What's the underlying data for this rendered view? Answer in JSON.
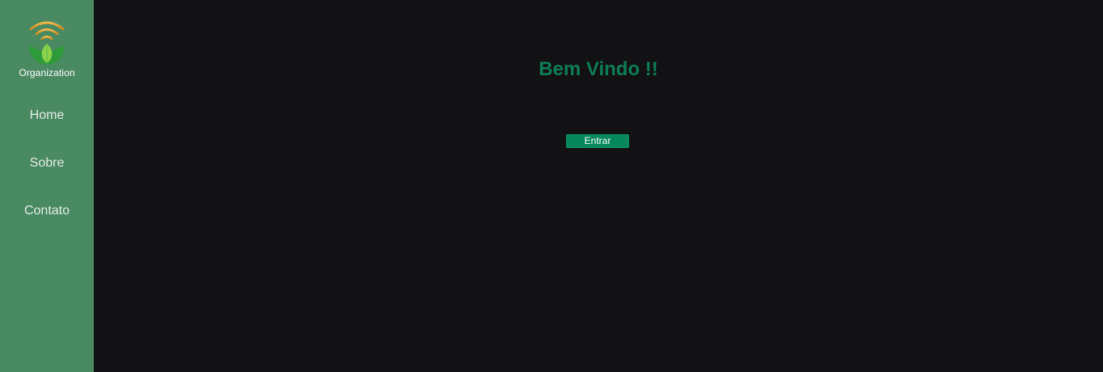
{
  "brand": {
    "name": "Organization",
    "icon": "sprout-signal-logo-icon",
    "colors": {
      "signal": "#e0a63a",
      "leaf_light": "#8bd34a",
      "leaf_dark": "#2e9b3a"
    }
  },
  "sidebar": {
    "background": "#4a8a62",
    "items": [
      {
        "label": "Home"
      },
      {
        "label": "Sobre"
      },
      {
        "label": "Contato"
      }
    ]
  },
  "main": {
    "background": "#121214",
    "heading": "Bem Vindo !!",
    "heading_color": "#0c7d55",
    "enter_button": {
      "label": "Entrar",
      "color": "#04875a"
    }
  }
}
